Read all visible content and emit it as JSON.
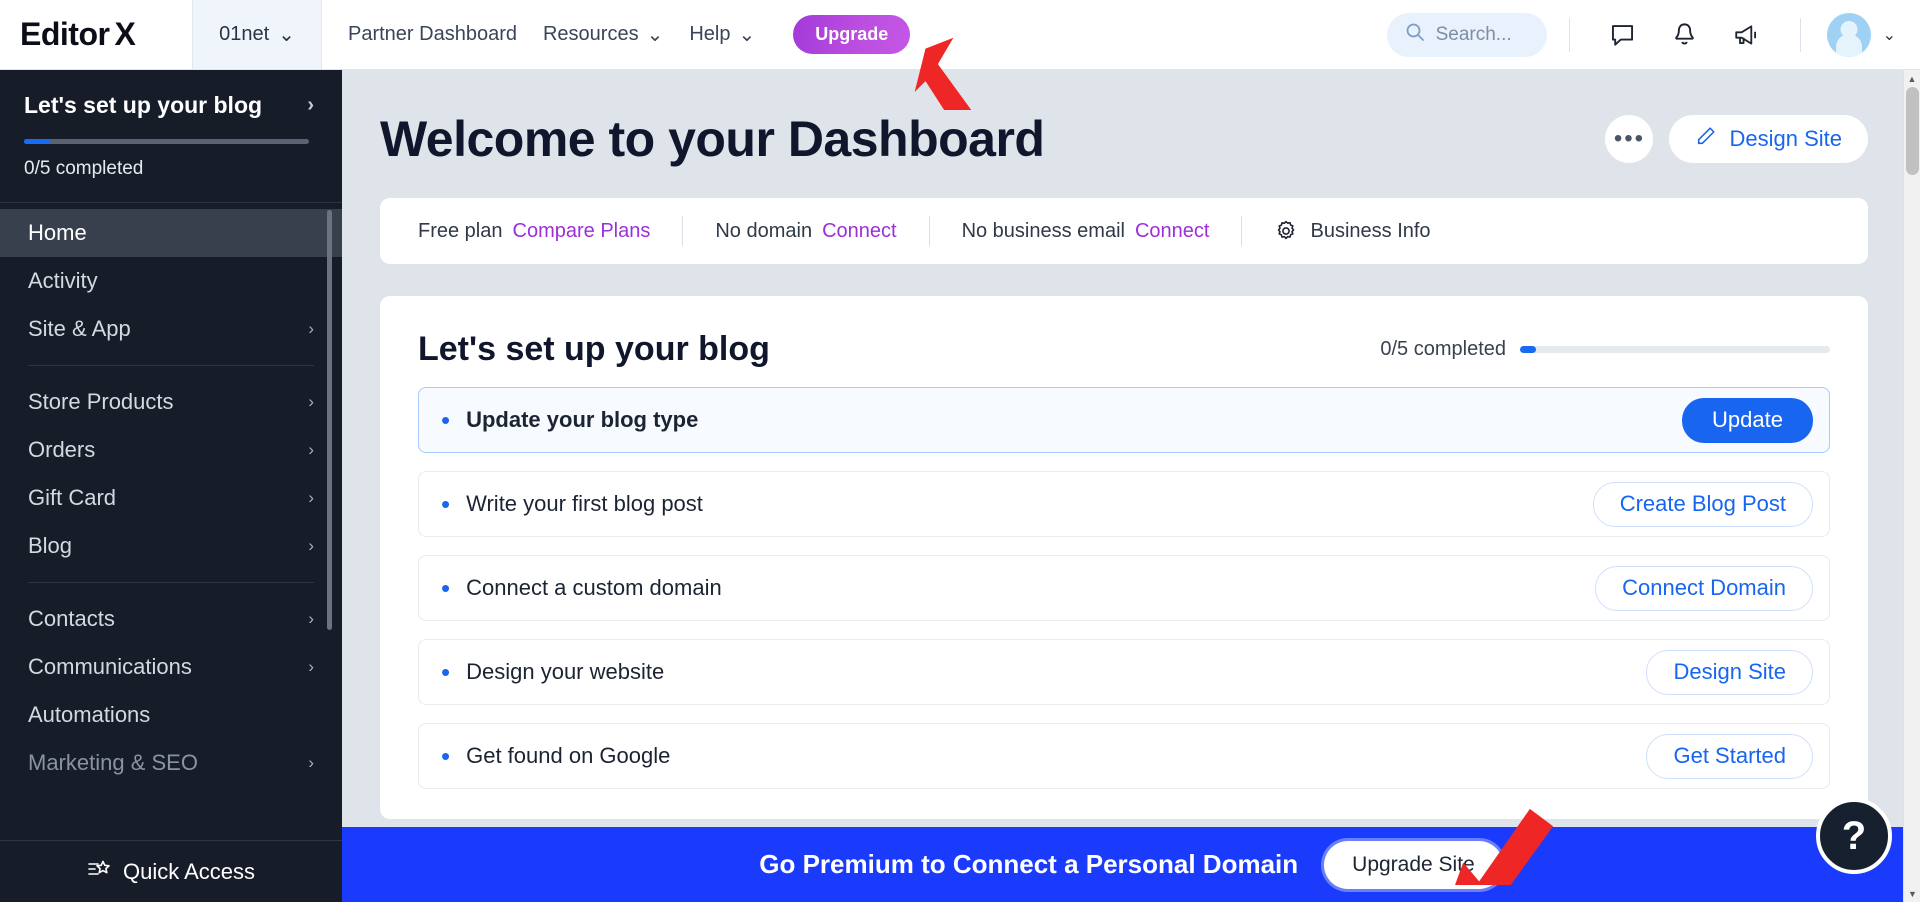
{
  "topbar": {
    "brand": "Editor",
    "brand_x": "X",
    "site_name": "01net",
    "site_caret": "⌄",
    "nav": [
      {
        "label": "Partner Dashboard",
        "caret": ""
      },
      {
        "label": "Resources",
        "caret": "⌄"
      },
      {
        "label": "Help",
        "caret": "⌄"
      }
    ],
    "upgrade_label": "Upgrade",
    "search_placeholder": "Search...",
    "icons": [
      "chat-icon",
      "bell-icon",
      "megaphone-icon"
    ],
    "avatar_caret": "⌄"
  },
  "sidebar": {
    "setup_title": "Let's set up your blog",
    "setup_chevron": "›",
    "setup_progress_text": "0/5 completed",
    "items": [
      {
        "label": "Home",
        "chevron": "",
        "state": "active"
      },
      {
        "label": "Activity",
        "chevron": "",
        "state": "normal"
      },
      {
        "label": "Site & App",
        "chevron": "›",
        "state": "normal"
      },
      {
        "label": "Store Products",
        "chevron": "›",
        "state": "normal"
      },
      {
        "label": "Orders",
        "chevron": "›",
        "state": "normal"
      },
      {
        "label": "Gift Card",
        "chevron": "›",
        "state": "normal"
      },
      {
        "label": "Blog",
        "chevron": "›",
        "state": "normal"
      },
      {
        "label": "Contacts",
        "chevron": "›",
        "state": "normal"
      },
      {
        "label": "Communications",
        "chevron": "›",
        "state": "normal"
      },
      {
        "label": "Automations",
        "chevron": "",
        "state": "normal"
      },
      {
        "label": "Marketing & SEO",
        "chevron": "›",
        "state": "dim"
      }
    ],
    "quick_access": "Quick Access"
  },
  "main": {
    "page_title": "Welcome to your Dashboard",
    "dots_label": "•••",
    "design_site_label": "Design Site",
    "info_bar": {
      "plan_text": "Free plan",
      "plan_link": "Compare Plans",
      "domain_text": "No domain",
      "domain_link": "Connect",
      "email_text": "No business email",
      "email_link": "Connect",
      "business_info": "Business Info"
    },
    "setup": {
      "title": "Let's set up your blog",
      "progress_label": "0/5 completed",
      "tasks": [
        {
          "label": "Update your blog type",
          "action": "Update",
          "style": "primary",
          "active": true
        },
        {
          "label": "Write your first blog post",
          "action": "Create Blog Post",
          "style": "outline",
          "active": false
        },
        {
          "label": "Connect a custom domain",
          "action": "Connect Domain",
          "style": "outline",
          "active": false
        },
        {
          "label": "Design your website",
          "action": "Design Site",
          "style": "outline",
          "active": false
        },
        {
          "label": "Get found on Google",
          "action": "Get Started",
          "style": "outline",
          "active": false
        }
      ]
    }
  },
  "banner": {
    "text": "Go Premium to Connect a Personal Domain",
    "button": "Upgrade Site"
  },
  "help": {
    "label": "?"
  },
  "colors": {
    "brand_dark": "#161d29",
    "accent_blue": "#1866f0",
    "banner_blue": "#1a3bfb",
    "upgrade_purple": "#bb4ee0",
    "link_purple": "#9b30d9",
    "main_bg": "#dfe3ea",
    "arrow_red": "#ef2626"
  }
}
